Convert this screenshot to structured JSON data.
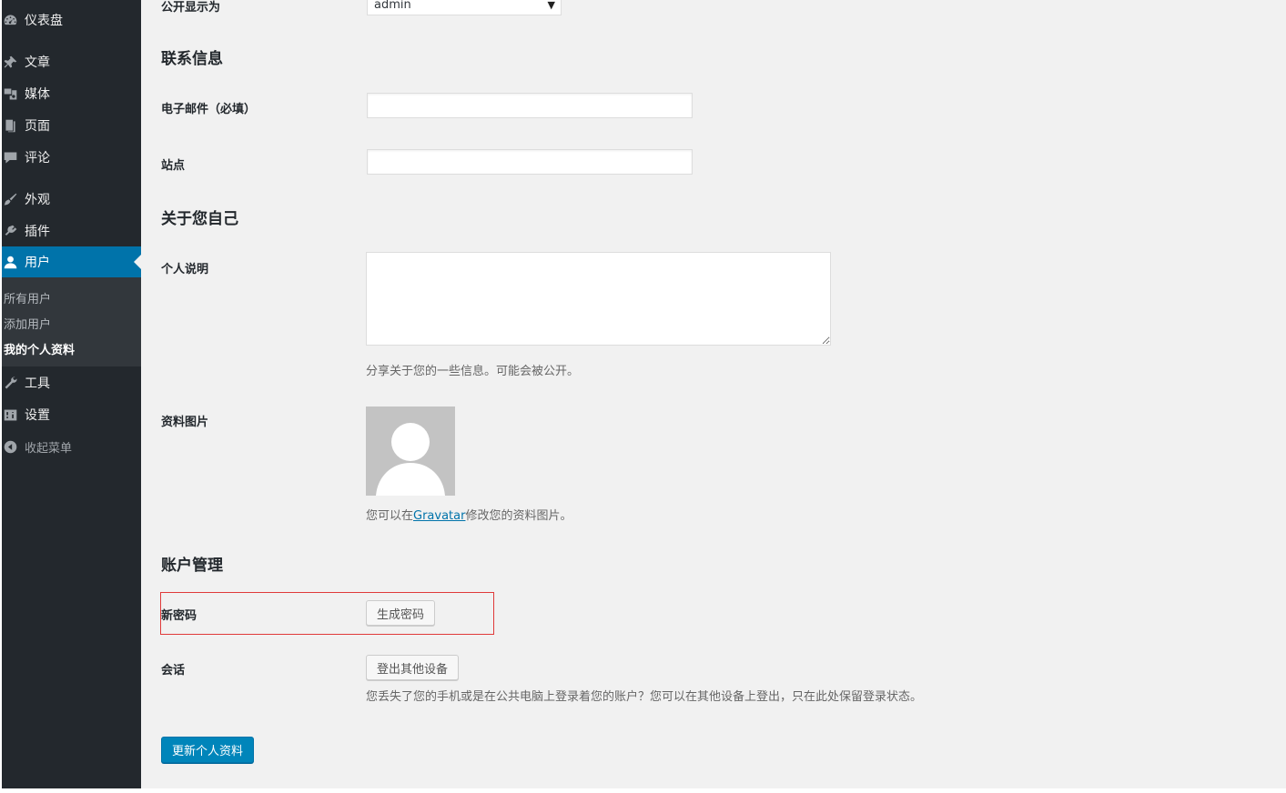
{
  "sidebar": {
    "items": [
      {
        "label": "仪表盘",
        "icon": "dashboard-icon"
      },
      {
        "label": "文章",
        "icon": "pin-icon"
      },
      {
        "label": "媒体",
        "icon": "media-icon"
      },
      {
        "label": "页面",
        "icon": "page-icon"
      },
      {
        "label": "评论",
        "icon": "comment-icon"
      },
      {
        "label": "外观",
        "icon": "brush-icon"
      },
      {
        "label": "插件",
        "icon": "plugin-icon"
      },
      {
        "label": "用户",
        "icon": "user-icon"
      },
      {
        "label": "工具",
        "icon": "wrench-icon"
      },
      {
        "label": "设置",
        "icon": "settings-icon"
      },
      {
        "label": "收起菜单",
        "icon": "collapse-icon"
      }
    ],
    "submenu": [
      "所有用户",
      "添加用户",
      "我的个人资料"
    ],
    "active_color": "#0073aa"
  },
  "form": {
    "display_name_label": "公开显示为",
    "display_name_value": "admin",
    "contact_heading": "联系信息",
    "email_label": "电子邮件（必填）",
    "email_value": "",
    "site_label": "站点",
    "site_value": "",
    "about_heading": "关于您自己",
    "bio_label": "个人说明",
    "bio_value": "",
    "bio_desc": "分享关于您的一些信息。可能会被公开。",
    "avatar_label": "资料图片",
    "avatar_desc_before": "您可以在",
    "avatar_desc_link": "Gravatar",
    "avatar_desc_after": "修改您的资料图片。",
    "account_heading": "账户管理",
    "new_password_label": "新密码",
    "generate_password_button": "生成密码",
    "sessions_label": "会话",
    "logout_others_button": "登出其他设备",
    "sessions_desc": "您丢失了您的手机或是在公共电脑上登录着您的账户？您可以在其他设备上登出，只在此处保留登录状态。",
    "submit_button": "更新个人资料"
  }
}
